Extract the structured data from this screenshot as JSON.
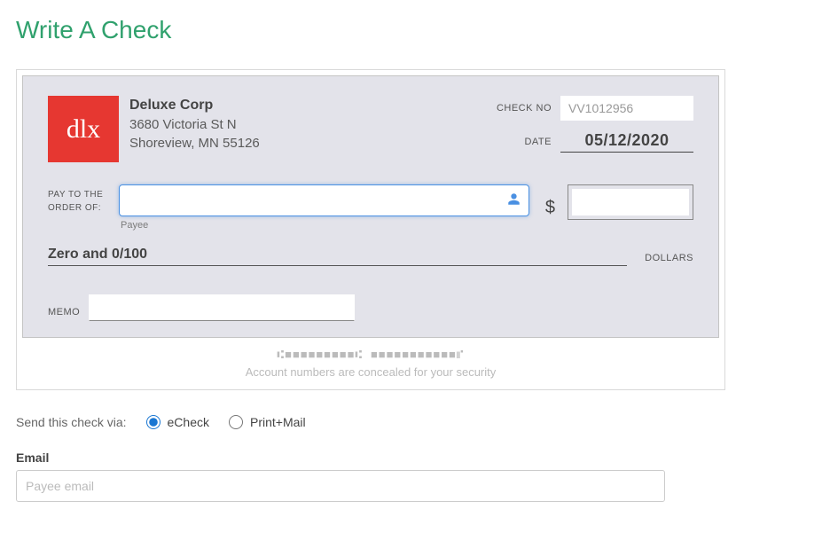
{
  "page": {
    "title": "Write A Check"
  },
  "from": {
    "logo_text": "dlx",
    "name": "Deluxe Corp",
    "addr1": "3680 Victoria St N",
    "addr2": "Shoreview, MN 55126"
  },
  "labels": {
    "check_no": "CHECK NO",
    "date": "DATE",
    "pay_to_order1": "PAY TO THE",
    "pay_to_order2": "ORDER OF:",
    "payee_sub": "Payee",
    "dollars": "DOLLARS",
    "memo": "MEMO",
    "concealed": "Account numbers are concealed for your security",
    "send_via": "Send this check via:",
    "option_echeck": "eCheck",
    "option_printmail": "Print+Mail",
    "email": "Email",
    "dollar_sign": "$"
  },
  "values": {
    "check_no": "VV1012956",
    "date": "05/12/2020",
    "payee": "",
    "amount": "",
    "amount_written": "Zero and 0/100",
    "memo": "",
    "email_placeholder": "Payee email",
    "micr": "⑆■■■■■■■■■⑆ ■■■■■■■■■■■⑈"
  },
  "send_via_selected": "echeck"
}
